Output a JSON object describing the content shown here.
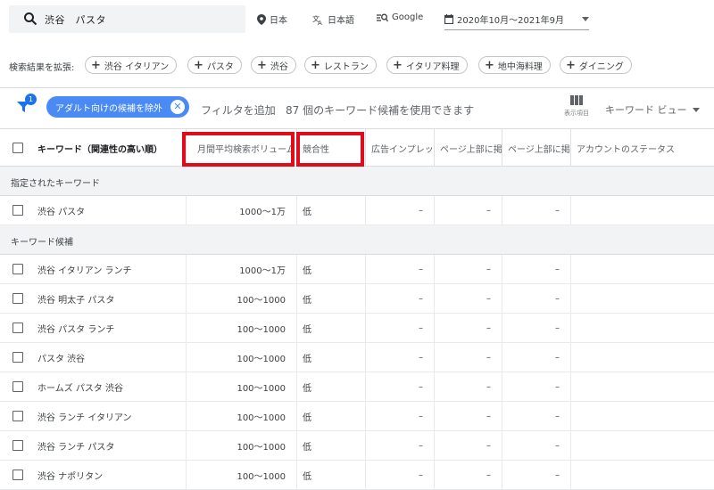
{
  "search": {
    "value": "渋谷　パスタ"
  },
  "top": {
    "location": "日本",
    "language": "日本語",
    "engine": "Google",
    "date_range": "2020年10月～2021年9月"
  },
  "expand": {
    "label": "検索結果を拡張:",
    "chips": [
      "渋谷 イタリアン",
      "パスタ",
      "渋谷",
      "レストラン",
      "イタリア料理",
      "地中海料理",
      "ダイニング"
    ]
  },
  "filter": {
    "badge": "1",
    "adult_chip": "アダルト向けの候補を除外",
    "add_filter": "フィルタを追加",
    "count_text": "87 個のキーワード候補を使用できます",
    "columns_label": "表示項目",
    "keyword_view": "キーワード ビュー"
  },
  "table": {
    "headers": {
      "keyword": "キーワード（関連性の高い順）",
      "volume": "月間平均検索ボリューム",
      "competition": "競合性",
      "impression": "広告インプレッ",
      "top_low": "ページ上部に掲",
      "top_high": "ページ上部に掲",
      "account": "アカウントのステータス"
    },
    "section1": "指定されたキーワード",
    "section2": "キーワード候補",
    "specified_rows": [
      {
        "keyword": "渋谷 パスタ",
        "volume": "1000～1万",
        "competition": "低",
        "impression": "–",
        "top_low": "–",
        "top_high": "–"
      }
    ],
    "candidate_rows": [
      {
        "keyword": "渋谷 イタリアン ランチ",
        "volume": "1000～1万",
        "competition": "低",
        "impression": "–",
        "top_low": "–",
        "top_high": "–"
      },
      {
        "keyword": "渋谷 明太子 パスタ",
        "volume": "100～1000",
        "competition": "低",
        "impression": "–",
        "top_low": "–",
        "top_high": "–"
      },
      {
        "keyword": "渋谷 パスタ ランチ",
        "volume": "100～1000",
        "competition": "低",
        "impression": "–",
        "top_low": "–",
        "top_high": "–"
      },
      {
        "keyword": "パスタ 渋谷",
        "volume": "100～1000",
        "competition": "低",
        "impression": "–",
        "top_low": "–",
        "top_high": "–"
      },
      {
        "keyword": "ホームズ パスタ 渋谷",
        "volume": "100～1000",
        "competition": "低",
        "impression": "–",
        "top_low": "–",
        "top_high": "–"
      },
      {
        "keyword": "渋谷 ランチ イタリアン",
        "volume": "100～1000",
        "competition": "低",
        "impression": "–",
        "top_low": "–",
        "top_high": "–"
      },
      {
        "keyword": "渋谷 ランチ パスタ",
        "volume": "100～1000",
        "competition": "低",
        "impression": "–",
        "top_low": "–",
        "top_high": "–"
      },
      {
        "keyword": "渋谷 ナポリタン",
        "volume": "100～1000",
        "competition": "低",
        "impression": "–",
        "top_low": "–",
        "top_high": "–"
      }
    ]
  }
}
